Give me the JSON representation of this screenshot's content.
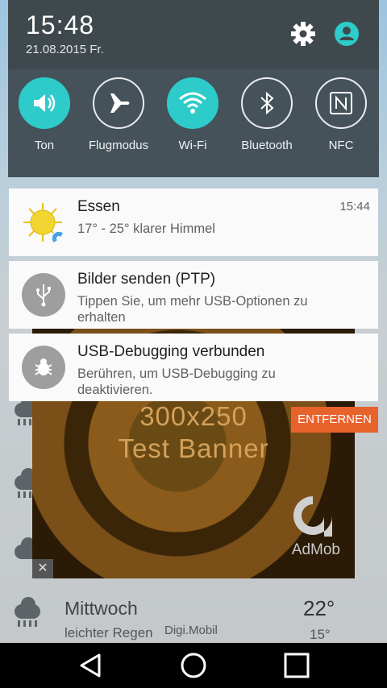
{
  "status": {
    "time": "15:48",
    "date": "21.08.2015 Fr."
  },
  "quick_settings": [
    {
      "label": "Ton",
      "icon": "volume-icon",
      "active": true
    },
    {
      "label": "Flugmodus",
      "icon": "airplane-icon",
      "active": false
    },
    {
      "label": "Wi-Fi",
      "icon": "wifi-icon",
      "active": true
    },
    {
      "label": "Bluetooth",
      "icon": "bluetooth-icon",
      "active": false
    },
    {
      "label": "NFC",
      "icon": "nfc-icon",
      "active": false
    }
  ],
  "notifications": [
    {
      "title": "Essen",
      "text": "17° - 25° klarer Himmel",
      "time": "15:44",
      "icon": "sun-icon"
    },
    {
      "title": "Bilder senden (PTP)",
      "text": "Tippen Sie, um mehr USB-Optionen zu erhalten",
      "icon": "usb-icon"
    },
    {
      "title": "USB-Debugging verbunden",
      "text": "Berühren, um USB-Debugging zu deaktivieren.",
      "icon": "bug-icon"
    }
  ],
  "ad": {
    "line1": "300x250",
    "line2": "Test Banner",
    "brand": "AdMob",
    "close": "✕",
    "remove_label": "ENTFERNEN"
  },
  "forecast": {
    "day": "Mittwoch",
    "description": "leichter Regen",
    "high": "22°",
    "low": "15°",
    "carrier": "Digi.Mobil"
  },
  "colors": {
    "accent": "#2ecbcb",
    "header_bg": "#3f494d",
    "remove_button": "#e8622c"
  }
}
